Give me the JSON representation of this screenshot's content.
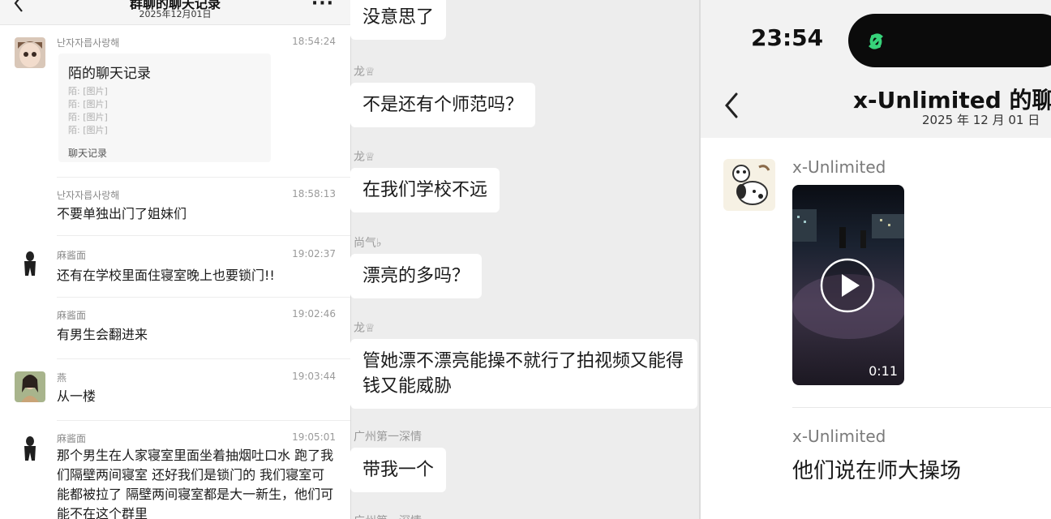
{
  "left": {
    "header": {
      "title": "群聊的聊天记录",
      "date": "2025年12月01日"
    },
    "messages": [
      {
        "sender": "난자자릅사랑해",
        "time": "18:54:24",
        "card": {
          "title": "陌的聊天记录",
          "lines": [
            "陌: [图片]",
            "陌: [图片]",
            "陌: [图片]",
            "陌: [图片]"
          ],
          "footer": "聊天记录"
        }
      },
      {
        "sender": "난자자릅사랑해",
        "time": "18:58:13",
        "text": "不要单独出门了姐妹们"
      },
      {
        "sender": "麻酱面",
        "time": "19:02:37",
        "text": "还有在学校里面住寝室晚上也要锁门!!"
      },
      {
        "sender": "麻酱面",
        "time": "19:02:46",
        "text": "有男生会翻进来"
      },
      {
        "sender": "燕",
        "time": "19:03:44",
        "text": "从一楼"
      },
      {
        "sender": "麻酱面",
        "time": "19:05:01",
        "text": "那个男生在人家寝室里面坐着抽烟吐口水 跑了我们隔壁两间寝室 还好我们是锁门的 我们寝室可能都被拉了 隔壁两间寝室都是大一新生，他们可能不在这个群里"
      }
    ]
  },
  "middle": {
    "items": [
      {
        "text": "没意思了"
      },
      {
        "name": "龙♕",
        "text": "不是还有个师范吗？"
      },
      {
        "name": "龙♕",
        "text": "在我们学校不远"
      },
      {
        "name": "尚气♭",
        "text": "漂亮的多吗？"
      },
      {
        "name": "龙♕",
        "text": "管她漂不漂亮能操不就行了拍视频又能得钱又能威胁"
      },
      {
        "name": "广州第一深情",
        "text": "带我一个"
      },
      {
        "name": "广州第一深情"
      }
    ]
  },
  "right": {
    "status": {
      "time": "23:54"
    },
    "header": {
      "title": "x-Unlimited 的聊天",
      "date": "2025 年 12 月 01 日"
    },
    "messages": [
      {
        "sender": "x-Unlimited",
        "video_duration": "0:11"
      },
      {
        "sender": "x-Unlimited",
        "text": "他们说在师大操场"
      }
    ],
    "colors": {
      "island_icon": "#37d27a"
    }
  }
}
